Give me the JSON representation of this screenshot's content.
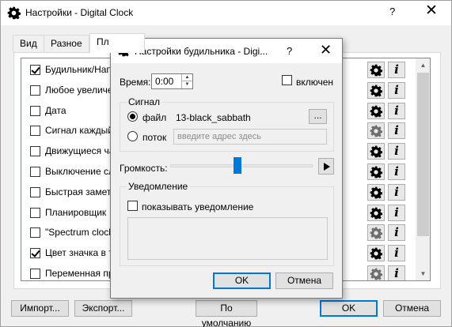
{
  "main_window": {
    "title": "Настройки - Digital Clock",
    "help_glyph": "?",
    "close_glyph": "✕"
  },
  "tabs": [
    "Вид",
    "Разное",
    "Пл"
  ],
  "plugins": [
    {
      "label": "Будильник/Нап",
      "checked": true,
      "gear_active": true
    },
    {
      "label": "Любое увеличе",
      "checked": false,
      "gear_active": true
    },
    {
      "label": "Дата",
      "checked": false,
      "gear_active": true
    },
    {
      "label": "Сигнал каждый",
      "checked": false,
      "gear_active": false
    },
    {
      "label": "Движущиеся ча",
      "checked": false,
      "gear_active": true
    },
    {
      "label": "Выключение сл",
      "checked": false,
      "gear_active": true
    },
    {
      "label": "Быстрая заметк",
      "checked": false,
      "gear_active": true
    },
    {
      "label": "Планировщик",
      "checked": false,
      "gear_active": true
    },
    {
      "label": "\"Spectrum clock",
      "checked": false,
      "gear_active": false
    },
    {
      "label": "Цвет значка в тр",
      "checked": true,
      "gear_active": true
    },
    {
      "label": "Переменная пр",
      "checked": false,
      "gear_active": false
    }
  ],
  "info_glyph": "i",
  "bottom_buttons": {
    "import": "Импорт...",
    "export": "Экспорт...",
    "defaults": "По умолчанию",
    "ok": "OK",
    "cancel": "Отмена"
  },
  "dialog": {
    "title": "Настройки будильника - Digi...",
    "help_glyph": "?",
    "close_glyph": "✕",
    "time_label": "Время:",
    "time_value": "0:00",
    "enabled_label": "включен",
    "signal_group": "Сигнал",
    "file_label": "файл",
    "file_value": "13-black_sabbath",
    "browse_label": "...",
    "stream_label": "поток",
    "stream_placeholder": "введите адрес здесь",
    "volume_label": "Громкость:",
    "volume_level": 0.47,
    "notification_group": "Уведомление",
    "show_notification_label": "показывать уведомление",
    "ok": "OK",
    "cancel": "Отмена"
  },
  "colors": {
    "accent": "#0078d7",
    "gear_active": "#000000",
    "gear_inactive": "#6e6e6e"
  }
}
